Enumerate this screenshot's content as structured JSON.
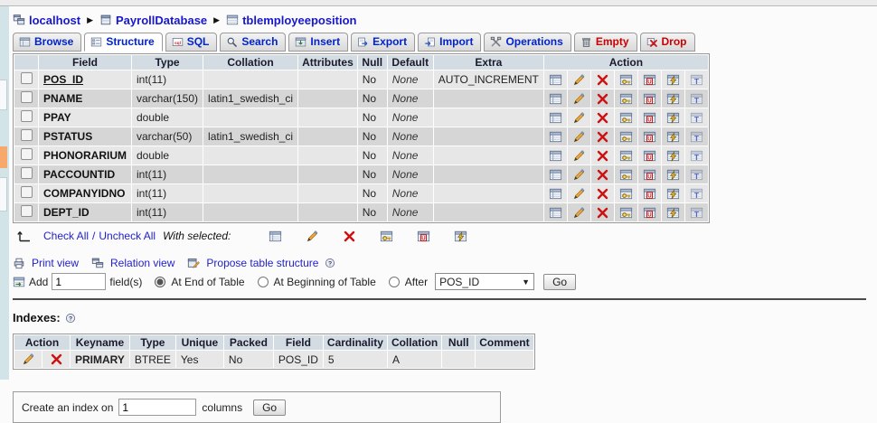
{
  "colors": {
    "link_blue": "#1717cc",
    "tab_blue": "#0023cc",
    "danger_red": "#cc0000",
    "table_header_bg": "#d3dce3"
  },
  "breadcrumb": {
    "items": [
      {
        "label": "localhost",
        "icon": "server-icon"
      },
      {
        "label": "PayrollDatabase",
        "icon": "database-icon"
      },
      {
        "label": "tblemployeeposition",
        "icon": "table-icon"
      }
    ],
    "separator": "▶"
  },
  "tabs": [
    {
      "label": "Browse",
      "icon": "tab-browse-icon",
      "style": "blue",
      "active": false
    },
    {
      "label": "Structure",
      "icon": "tab-structure-icon",
      "style": "blue",
      "active": true
    },
    {
      "label": "SQL",
      "icon": "tab-sql-icon",
      "style": "blue",
      "active": false
    },
    {
      "label": "Search",
      "icon": "tab-search-icon",
      "style": "blue",
      "active": false
    },
    {
      "label": "Insert",
      "icon": "tab-insert-icon",
      "style": "blue",
      "active": false
    },
    {
      "label": "Export",
      "icon": "tab-export-icon",
      "style": "blue",
      "active": false
    },
    {
      "label": "Import",
      "icon": "tab-import-icon",
      "style": "blue",
      "active": false
    },
    {
      "label": "Operations",
      "icon": "tab-operations-icon",
      "style": "blue",
      "active": false
    },
    {
      "label": "Empty",
      "icon": "tab-empty-icon",
      "style": "red",
      "active": false
    },
    {
      "label": "Drop",
      "icon": "tab-drop-icon",
      "style": "red",
      "active": false
    }
  ],
  "structure_table": {
    "headers": [
      "Field",
      "Type",
      "Collation",
      "Attributes",
      "Null",
      "Default",
      "Extra",
      "Action"
    ],
    "action_icons": [
      "browse",
      "change",
      "drop",
      "primary",
      "unique",
      "index",
      "fulltext"
    ],
    "rows": [
      {
        "field": "POS_ID",
        "primary": true,
        "type": "int(11)",
        "collation": "",
        "attributes": "",
        "null": "No",
        "default": "None",
        "extra": "AUTO_INCREMENT"
      },
      {
        "field": "PNAME",
        "primary": false,
        "type": "varchar(150)",
        "collation": "latin1_swedish_ci",
        "attributes": "",
        "null": "No",
        "default": "None",
        "extra": ""
      },
      {
        "field": "PPAY",
        "primary": false,
        "type": "double",
        "collation": "",
        "attributes": "",
        "null": "No",
        "default": "None",
        "extra": ""
      },
      {
        "field": "PSTATUS",
        "primary": false,
        "type": "varchar(50)",
        "collation": "latin1_swedish_ci",
        "attributes": "",
        "null": "No",
        "default": "None",
        "extra": ""
      },
      {
        "field": "PHONORARIUM",
        "primary": false,
        "type": "double",
        "collation": "",
        "attributes": "",
        "null": "No",
        "default": "None",
        "extra": ""
      },
      {
        "field": "PACCOUNTID",
        "primary": false,
        "type": "int(11)",
        "collation": "",
        "attributes": "",
        "null": "No",
        "default": "None",
        "extra": ""
      },
      {
        "field": "COMPANYIDNO",
        "primary": false,
        "type": "int(11)",
        "collation": "",
        "attributes": "",
        "null": "No",
        "default": "None",
        "extra": ""
      },
      {
        "field": "DEPT_ID",
        "primary": false,
        "type": "int(11)",
        "collation": "",
        "attributes": "",
        "null": "No",
        "default": "None",
        "extra": ""
      }
    ]
  },
  "check_all": {
    "check_all_label": "Check All",
    "slash": "/",
    "uncheck_all_label": "Uncheck All",
    "with_selected_label": "With selected:",
    "icons": [
      "browse",
      "change",
      "drop",
      "primary",
      "unique",
      "index"
    ]
  },
  "links_row": {
    "print_view": "Print view",
    "relation_view": "Relation view",
    "propose_structure": "Propose table structure"
  },
  "add_field": {
    "add_label": "Add",
    "value": "1",
    "fields_label": "field(s)",
    "option_end": "At End of Table",
    "option_begin": "At Beginning of Table",
    "option_after": "After",
    "after_selected": "POS_ID",
    "go_label": "Go"
  },
  "indexes": {
    "title": "Indexes:",
    "headers": [
      "Action",
      "Keyname",
      "Type",
      "Unique",
      "Packed",
      "Field",
      "Cardinality",
      "Collation",
      "Null",
      "Comment"
    ],
    "rows": [
      {
        "keyname": "PRIMARY",
        "type": "BTREE",
        "unique": "Yes",
        "packed": "No",
        "field": "POS_ID",
        "cardinality": "5",
        "collation": "A",
        "null": "",
        "comment": ""
      }
    ]
  },
  "create_index": {
    "label_before": "Create an index on",
    "value": "1",
    "label_after": "columns",
    "go_label": "Go"
  }
}
